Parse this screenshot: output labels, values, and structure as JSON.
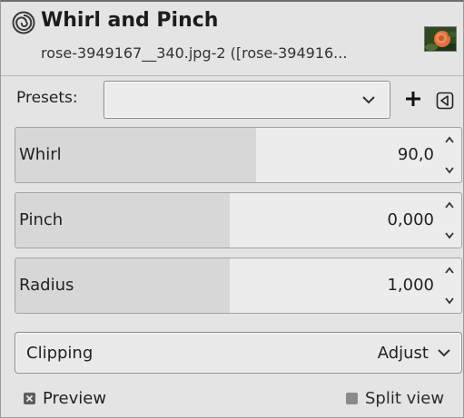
{
  "dialog": {
    "title": "Whirl and Pinch",
    "subtitle": "rose-3949167__340.jpg-2 ([rose-394916...",
    "icon": "whirl-pinch-icon",
    "thumbnail": "rose-image-thumbnail"
  },
  "presets": {
    "label": "Presets:",
    "value": "",
    "add_icon": "plus-icon",
    "menu_icon": "menu-triangle-icon"
  },
  "scales": [
    {
      "label": "Whirl",
      "value": "90,0",
      "fill_fraction": 0.54
    },
    {
      "label": "Pinch",
      "value": "0,000",
      "fill_fraction": 0.48
    },
    {
      "label": "Radius",
      "value": "1,000",
      "fill_fraction": 0.48
    }
  ],
  "clipping": {
    "label": "Clipping",
    "value": "Adjust"
  },
  "preview": {
    "label": "Preview",
    "checked": true
  },
  "split_view": {
    "label": "Split view",
    "checked": false
  }
}
